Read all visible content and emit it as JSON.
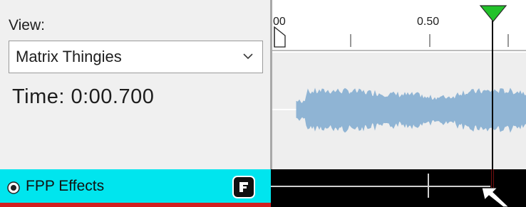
{
  "left_panel": {
    "view_label": "View:",
    "view_select_value": "Matrix Thingies",
    "time_label": "Time: 0:00.700"
  },
  "ruler": {
    "tick_labels": [
      {
        "text": "00"
      },
      {
        "text": "0.50"
      }
    ]
  },
  "effects_row": {
    "label": "FPP Effects",
    "button_glyph": "F"
  },
  "colors": {
    "effects_row_bg": "#00e5ee",
    "waveform": "#8fb4d4",
    "playhead_marker": "#22c22a",
    "effects_underline": "#d21f1f"
  },
  "icons": {
    "view_select_chevron": "chevron-down-icon",
    "effects_radio": "radio-selected-icon",
    "effects_button": "effects-f-icon",
    "playhead": "playhead-marker-icon",
    "start_marker": "start-marker-icon",
    "cursor": "mouse-cursor-icon"
  }
}
